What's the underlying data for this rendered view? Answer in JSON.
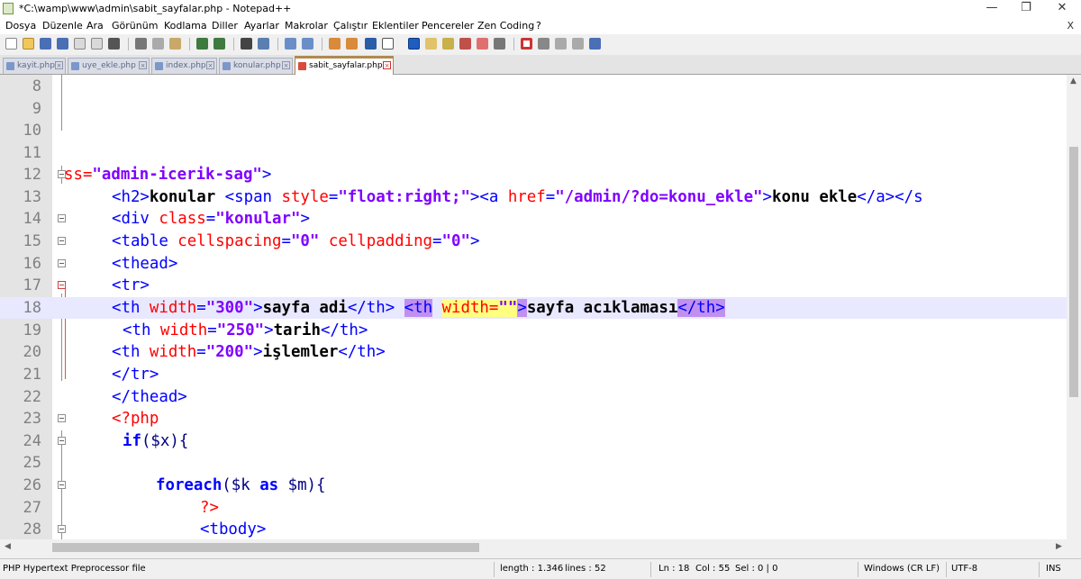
{
  "window": {
    "title": "*C:\\wamp\\www\\admin\\sabit_sayfalar.php - Notepad++",
    "minimize": "—",
    "restore": "❐",
    "close": "✕"
  },
  "menu": [
    "Dosya",
    "Düzenle",
    "Ara",
    "Görünüm",
    "Kodlama",
    "Diller",
    "Ayarlar",
    "Makrolar",
    "Çalıştır",
    "Eklentiler",
    "Pencereler",
    "Zen Coding",
    "?"
  ],
  "menu_close": "X",
  "tabs": [
    {
      "label": "kayit.php"
    },
    {
      "label": "uye_ekle.php"
    },
    {
      "label": "index.php"
    },
    {
      "label": "konular.php"
    },
    {
      "label": "sabit_sayfalar.php",
      "active": true
    }
  ],
  "editor": {
    "line_numbers": [
      "8",
      "9",
      "10",
      "11",
      "12",
      "13",
      "14",
      "15",
      "16",
      "17",
      "18",
      "19",
      "20",
      "21",
      "22",
      "23",
      "24",
      "25",
      "26",
      "27",
      "28"
    ],
    "current_line": "18",
    "lines": {
      "l12": {
        "a": "ss=",
        "b": "\"admin-icerik-sag\"",
        "c": ">"
      },
      "l13": {
        "a": "<h2>",
        "b": "konular ",
        "c": "<span ",
        "d": "style",
        "e": "=",
        "f": "\"float:right;\"",
        "g": "><a ",
        "h": "href",
        "i": "=",
        "j": "\"/admin/?do=konu_ekle\"",
        "k": ">",
        "l": "konu ekle",
        "m": "</a></s"
      },
      "l14": {
        "a": "<div ",
        "b": "class",
        "c": "=",
        "d": "\"konular\"",
        "e": ">"
      },
      "l15": {
        "a": "<table ",
        "b": "cellspacing",
        "c": "=",
        "d": "\"0\"",
        "e": " ",
        "f": "cellpadding",
        "g": "=",
        "h": "\"0\"",
        "i": ">"
      },
      "l16": {
        "a": "<thead>"
      },
      "l17": {
        "a": "<tr>"
      },
      "l18": {
        "a": "<th ",
        "b": "width",
        "c": "=",
        "d": "\"300\"",
        "e": ">",
        "f": "sayfa adi",
        "g": "</th> ",
        "h": "<th",
        "i": " ",
        "j": "width=",
        "k": "\"\"",
        "l": ">",
        "m": "sayfa acıklaması",
        "n": "</th>"
      },
      "l19": {
        "a": "<th ",
        "b": "width",
        "c": "=",
        "d": "\"250\"",
        "e": ">",
        "f": "tarih",
        "g": "</th>"
      },
      "l20": {
        "a": "<th ",
        "b": "width",
        "c": "=",
        "d": "\"200\"",
        "e": ">",
        "f": "işlemler",
        "g": "</th>"
      },
      "l21": {
        "a": "</tr>"
      },
      "l22": {
        "a": "</thead>"
      },
      "l23": {
        "a": "<?php"
      },
      "l24": {
        "a": "if",
        "b": "($x){"
      },
      "l26": {
        "a": "foreach",
        "b": "($k ",
        "c": "as",
        "d": " $m){"
      },
      "l27": {
        "a": "?>"
      },
      "l28": {
        "a": "<tbody>"
      }
    }
  },
  "status": {
    "language": "PHP Hypertext Preprocessor file",
    "length": "length : 1.346",
    "lines": "lines : 52",
    "ln": "Ln : 18",
    "col": "Col : 55",
    "sel": "Sel : 0 | 0",
    "eol": "Windows (CR LF)",
    "encoding": "UTF-8",
    "mode": "INS"
  }
}
